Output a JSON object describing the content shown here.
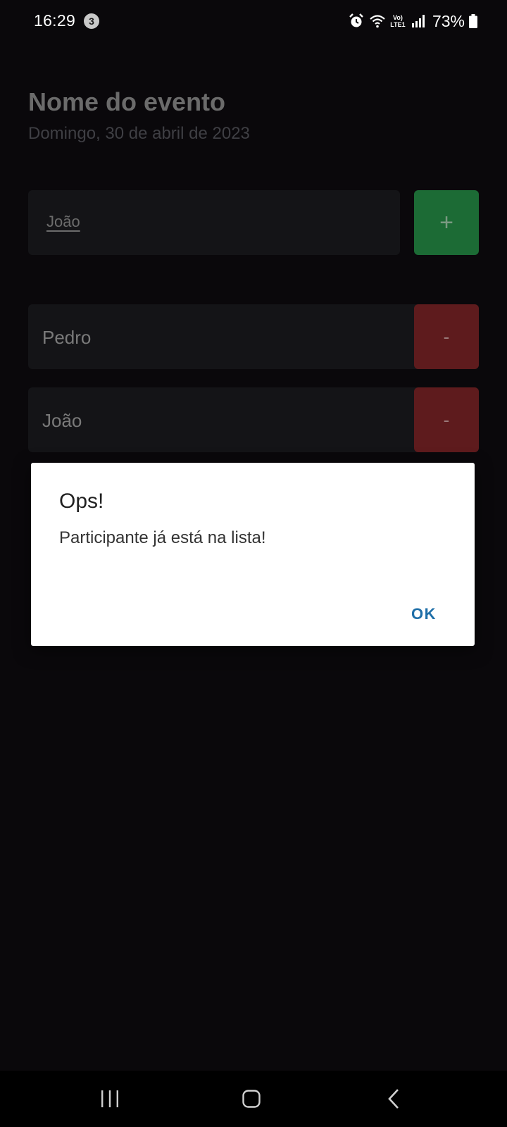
{
  "status_bar": {
    "time": "16:29",
    "notification_count": "3",
    "network_label": "Vo) LTE1",
    "battery_percent": "73%"
  },
  "event": {
    "title": "Nome do evento",
    "date": "Domingo, 30 de abril de 2023"
  },
  "participant_input": {
    "value": "João"
  },
  "add_button": {
    "label": "+"
  },
  "participants": [
    {
      "name": "Pedro",
      "remove_label": "-"
    },
    {
      "name": "João",
      "remove_label": "-"
    }
  ],
  "dialog": {
    "title": "Ops!",
    "message": "Participante já está na lista!",
    "ok_label": "OK"
  },
  "colors": {
    "background": "#0a080b",
    "add_button": "#1c6b35",
    "remove_button": "#5e1b1d",
    "dialog_accent": "#1f6fa8"
  },
  "nav_bar": {
    "icons": [
      "recent-apps-icon",
      "home-icon",
      "back-icon"
    ]
  }
}
